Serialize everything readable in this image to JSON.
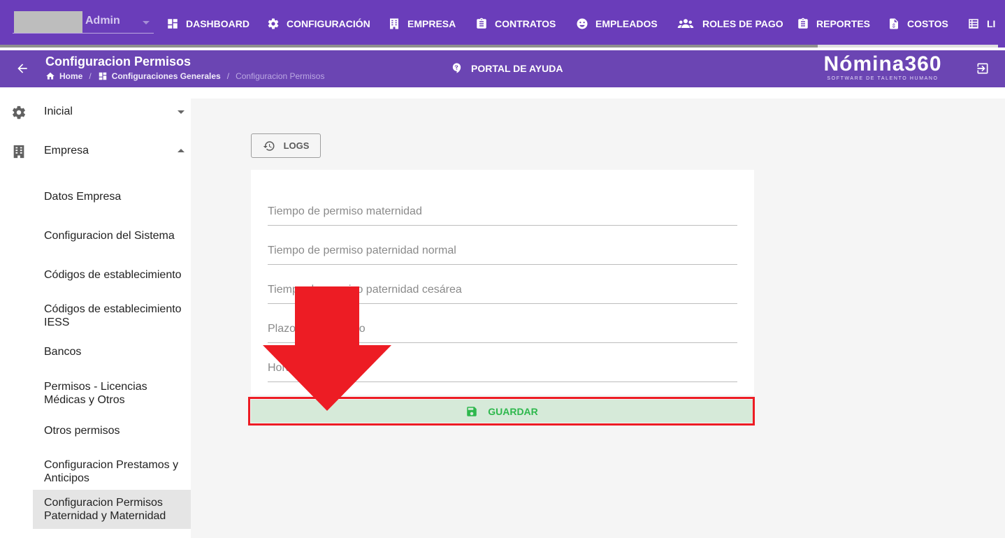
{
  "topnav": {
    "user_name": "Admin",
    "items": [
      {
        "label": "DASHBOARD",
        "icon": "dashboard-icon"
      },
      {
        "label": "CONFIGURACIÓN",
        "icon": "gear-icon"
      },
      {
        "label": "EMPRESA",
        "icon": "building-icon"
      },
      {
        "label": "CONTRATOS",
        "icon": "clipboard-icon"
      },
      {
        "label": "EMPLEADOS",
        "icon": "face-icon"
      },
      {
        "label": "ROLES DE PAGO",
        "icon": "people-icon"
      },
      {
        "label": "REPORTES",
        "icon": "clipboard-report-icon"
      },
      {
        "label": "COSTOS",
        "icon": "dollar-file-icon"
      },
      {
        "label": "LI",
        "icon": "list-icon"
      }
    ]
  },
  "subheader": {
    "title": "Configuracion Permisos",
    "breadcrumb": {
      "home": "Home",
      "section": "Configuraciones Generales",
      "current": "Configuracion Permisos",
      "separator": "/"
    },
    "help_label": "PORTAL DE AYUDA",
    "logo_main": "Nómina360",
    "logo_sub": "SOFTWARE DE TALENTO HUMANO"
  },
  "sidebar": {
    "parents": [
      {
        "label": "Inicial",
        "icon": "gear-icon"
      },
      {
        "label": "Empresa",
        "icon": "building-icon"
      }
    ],
    "items": [
      "Datos Empresa",
      "Configuracion del Sistema",
      "Códigos de establecimiento",
      "Códigos de establecimiento IESS",
      "Bancos",
      "Permisos - Licencias Médicas y Otros",
      "Otros permisos",
      "Configuracion Prestamos y Anticipos",
      "Configuracion Permisos Paternidad y Maternidad"
    ]
  },
  "main": {
    "logs_label": "LOGS",
    "fields": [
      {
        "placeholder": "Tiempo de permiso maternidad"
      },
      {
        "placeholder": "Tiempo de permiso paternidad normal"
      },
      {
        "placeholder": "Tiempo de permiso paternidad cesárea"
      },
      {
        "placeholder": "Plazo para fallecido"
      },
      {
        "placeholder": "Horas para padres"
      }
    ],
    "save_label": "GUARDAR"
  },
  "colors": {
    "nav_bg": "#6a3dba",
    "subheader_bg": "#6b45b3",
    "save_bg": "#d6ead9",
    "save_text": "#2eb84d",
    "annotation_red": "#ed1c24"
  }
}
